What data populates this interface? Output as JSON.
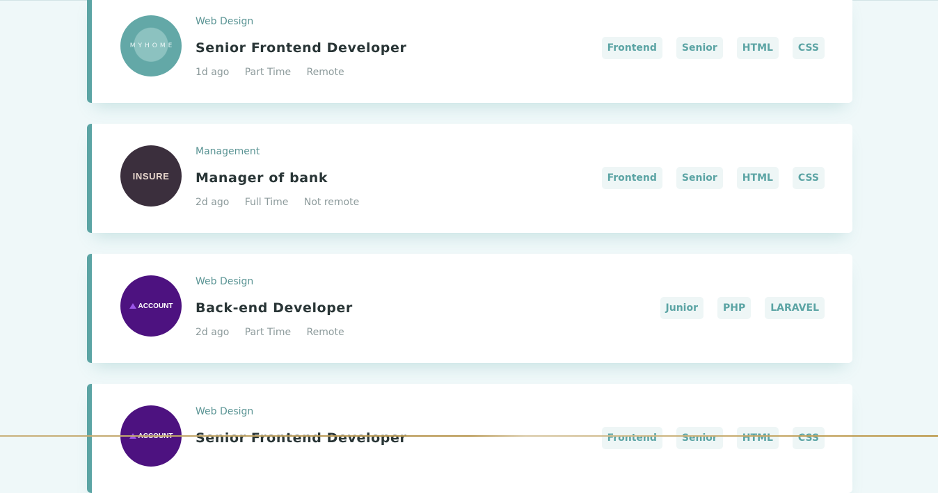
{
  "jobs": [
    {
      "company_logo_text": "MYHOME",
      "category": "Web Design",
      "title": "Senior Frontend Developer",
      "posted": "1d ago",
      "contract": "Part Time",
      "location": "Remote",
      "tags": [
        "Frontend",
        "Senior",
        "HTML",
        "CSS"
      ]
    },
    {
      "company_logo_text": "INSURE",
      "category": "Management",
      "title": "Manager of bank",
      "posted": "2d ago",
      "contract": "Full Time",
      "location": "Not remote",
      "tags": [
        "Frontend",
        "Senior",
        "HTML",
        "CSS"
      ]
    },
    {
      "company_logo_text": "ACCOUNT",
      "category": "Web Design",
      "title": "Back-end Developer",
      "posted": "2d ago",
      "contract": "Part Time",
      "location": "Remote",
      "tags": [
        "Junior",
        "PHP",
        "LARAVEL"
      ]
    },
    {
      "company_logo_text": "ACCOUNT",
      "category": "Web Design",
      "title": "Senior Frontend Developer",
      "tags": [
        "Frontend",
        "Senior",
        "HTML",
        "CSS"
      ]
    }
  ]
}
